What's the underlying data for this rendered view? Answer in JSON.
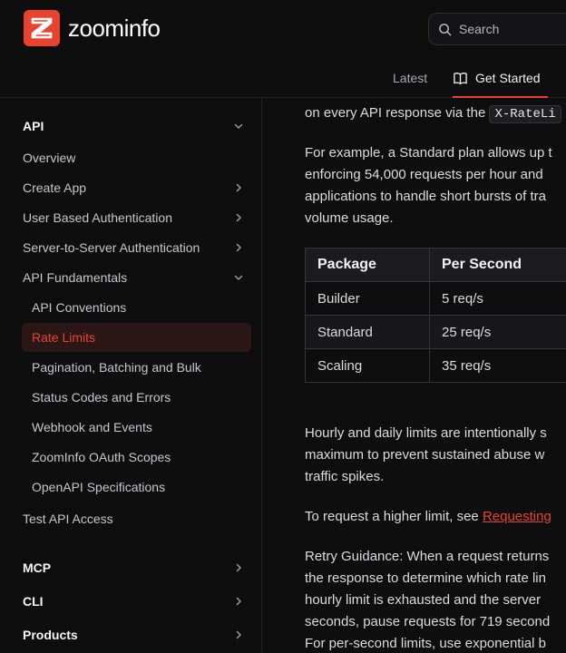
{
  "brand": {
    "name": "zoominfo",
    "accent": "#e8432f"
  },
  "search": {
    "placeholder": "Search",
    "icon": "search-icon"
  },
  "nav": {
    "tabs": [
      {
        "label": "Latest"
      },
      {
        "label": "Get Started",
        "icon": "book-icon",
        "active": true
      }
    ]
  },
  "sidebar": {
    "api_section": "API",
    "items": [
      {
        "label": "Overview"
      },
      {
        "label": "Create App"
      },
      {
        "label": "User Based Authentication"
      },
      {
        "label": "Server-to-Server Authentication"
      },
      {
        "label": "API Fundamentals"
      }
    ],
    "fundamentals": [
      {
        "label": "API Conventions"
      },
      {
        "label": "Rate Limits",
        "active": true
      },
      {
        "label": "Pagination, Batching and Bulk"
      },
      {
        "label": "Status Codes and Errors"
      },
      {
        "label": "Webhook and Events"
      },
      {
        "label": "ZoomInfo OAuth Scopes"
      },
      {
        "label": "OpenAPI Specifications"
      }
    ],
    "test_access": "Test API Access",
    "sections": [
      {
        "label": "MCP"
      },
      {
        "label": "CLI"
      },
      {
        "label": "Products"
      }
    ]
  },
  "content": {
    "para1_prefix": "on every API response via the",
    "para1_code": "X-RateLi",
    "para2": [
      "For example, a Standard plan allows up t",
      "enforcing 54,000 requests per hour and",
      "applications to handle short bursts of tra",
      "volume usage."
    ],
    "table": {
      "headers": [
        "Package",
        "Per Second"
      ],
      "rows": [
        [
          "Builder",
          "5 req/s"
        ],
        [
          "Standard",
          "25 req/s"
        ],
        [
          "Scaling",
          "35 req/s"
        ]
      ]
    },
    "para3": [
      "Hourly and daily limits are intentionally s",
      "maximum to prevent sustained abuse w",
      "traffic spikes."
    ],
    "para4_prefix": "To request a higher limit, see",
    "para4_link": "Requesting",
    "para5": [
      "Retry Guidance: When a request returns",
      "the response to determine which rate lin",
      "hourly limit is exhausted and the server",
      "seconds, pause requests for 719 second",
      "For per-second limits, use exponential b"
    ]
  }
}
